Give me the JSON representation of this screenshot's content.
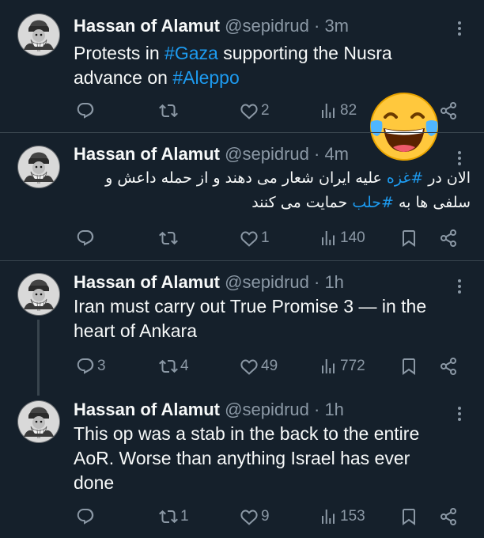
{
  "tweets": [
    {
      "name": "Hassan of Alamut",
      "handle": "@sepidrud",
      "time": "· 3m",
      "text_parts": [
        "Protests in ",
        "#Gaza",
        " supporting the Nusra",
        "advance on ",
        "#Aleppo"
      ],
      "replies": "",
      "retweets": "",
      "likes": "2",
      "views": "82"
    },
    {
      "name": "Hassan of Alamut",
      "handle": "@sepidrud",
      "time": "· 4m",
      "rtl_line1_a": "الان در ",
      "rtl_line1_tag": "#غزه",
      "rtl_line1_b": " علیه ایران شعار می دهند و از حمله داعش و",
      "rtl_line2_a": "سلفی ها به ",
      "rtl_line2_tag": "#حلب",
      "rtl_line2_b": " حمایت می کنند",
      "replies": "",
      "retweets": "",
      "likes": "1",
      "views": "140"
    },
    {
      "name": "Hassan of Alamut",
      "handle": "@sepidrud",
      "time": "· 1h",
      "text_line1": "Iran must carry out True Promise 3 — in the",
      "text_line2": "heart of Ankara",
      "replies": "3",
      "retweets": "4",
      "likes": "49",
      "views": "772"
    },
    {
      "name": "Hassan of Alamut",
      "handle": "@sepidrud",
      "time": "· 1h",
      "text_line1": "This op was a stab in the back to the entire",
      "text_line2": "AoR. Worse than anything Israel has ever",
      "text_line3": "done",
      "replies": "",
      "retweets": "1",
      "likes": "9",
      "views": "153"
    }
  ],
  "icons": {
    "reply": "reply-icon",
    "retweet": "retweet-icon",
    "like": "heart-icon",
    "views": "views-icon",
    "bookmark": "bookmark-icon",
    "share": "share-icon",
    "more": "more-icon",
    "overlay": "laughing-crying-emoji-icon"
  },
  "colors": {
    "background": "#15202b",
    "hashtag": "#1d9bf0",
    "secondary": "#8b98a5"
  }
}
